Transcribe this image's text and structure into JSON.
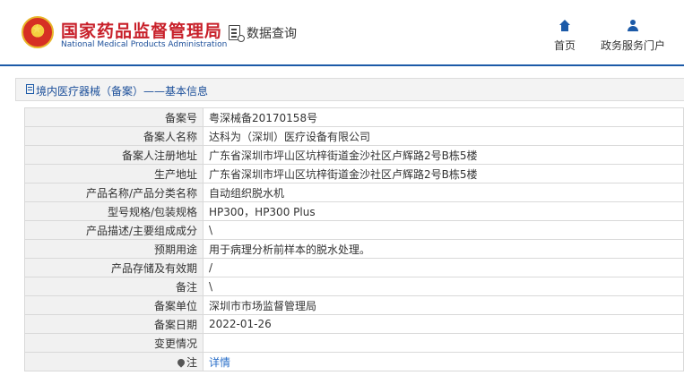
{
  "header": {
    "org_cn": "国家药品监督管理局",
    "org_en": "National Medical Products Administration",
    "search_label": "数据查询",
    "nav": [
      {
        "label": "首页",
        "icon": "home-icon"
      },
      {
        "label": "政务服务门户",
        "icon": "user-icon"
      }
    ]
  },
  "panel": {
    "title": "境内医疗器械（备案）——基本信息"
  },
  "details": [
    {
      "key": "备案号",
      "value": "粤深械备20170158号"
    },
    {
      "key": "备案人名称",
      "value": "达科为（深圳）医疗设备有限公司"
    },
    {
      "key": "备案人注册地址",
      "value": "广东省深圳市坪山区坑梓街道金沙社区卢辉路2号B栋5楼"
    },
    {
      "key": "生产地址",
      "value": "广东省深圳市坪山区坑梓街道金沙社区卢辉路2号B栋5楼"
    },
    {
      "key": "产品名称/产品分类名称",
      "value": "自动组织脱水机"
    },
    {
      "key": "型号规格/包装规格",
      "value": "HP300，HP300 Plus"
    },
    {
      "key": "产品描述/主要组成成分",
      "value": "\\"
    },
    {
      "key": "预期用途",
      "value": "用于病理分析前样本的脱水处理。"
    },
    {
      "key": "产品存储及有效期",
      "value": "/"
    },
    {
      "key": "备注",
      "value": "\\"
    },
    {
      "key": "备案单位",
      "value": "深圳市市场监督管理局"
    },
    {
      "key": "备案日期",
      "value": "2022-01-26"
    },
    {
      "key": "变更情况",
      "value": ""
    },
    {
      "key": "注",
      "value": "详情",
      "icon": "pin-icon"
    }
  ],
  "colors": {
    "brand_red": "#c8202a",
    "brand_blue": "#1c5aa8",
    "link": "#2a6fc9"
  }
}
